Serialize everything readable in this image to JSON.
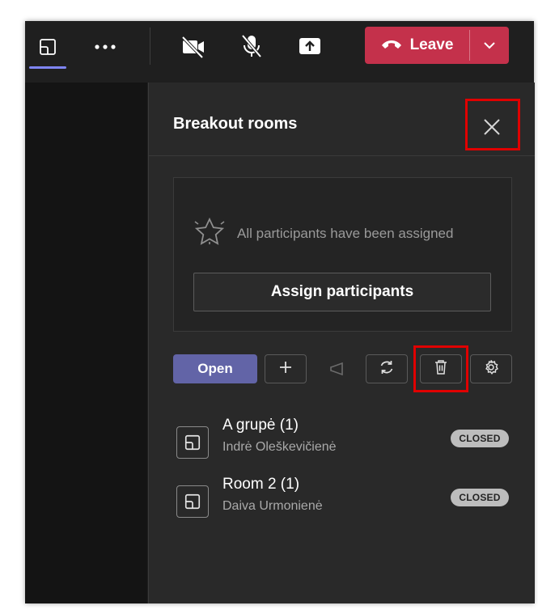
{
  "toolbar_top": {
    "leave_label": "Leave",
    "icons": [
      "share-tray-icon",
      "more-icon",
      "camera-off-icon",
      "mic-off-icon",
      "share-icon",
      "phone-hangup-icon",
      "chevron-down-icon"
    ]
  },
  "panel": {
    "title": "Breakout rooms",
    "assigned_status": "All participants have been assigned",
    "assign_button": "Assign participants",
    "open_button": "Open"
  },
  "rooms": [
    {
      "name": "A grupė (1)",
      "member": "Indrė Oleškevičienė",
      "status": "CLOSED"
    },
    {
      "name": "Room 2 (1)",
      "member": "Daiva Urmonienė",
      "status": "CLOSED"
    }
  ],
  "colors": {
    "accent": "#6264a7",
    "leave": "#c4314b",
    "highlight": "#e00000",
    "panel_bg": "#292929"
  }
}
